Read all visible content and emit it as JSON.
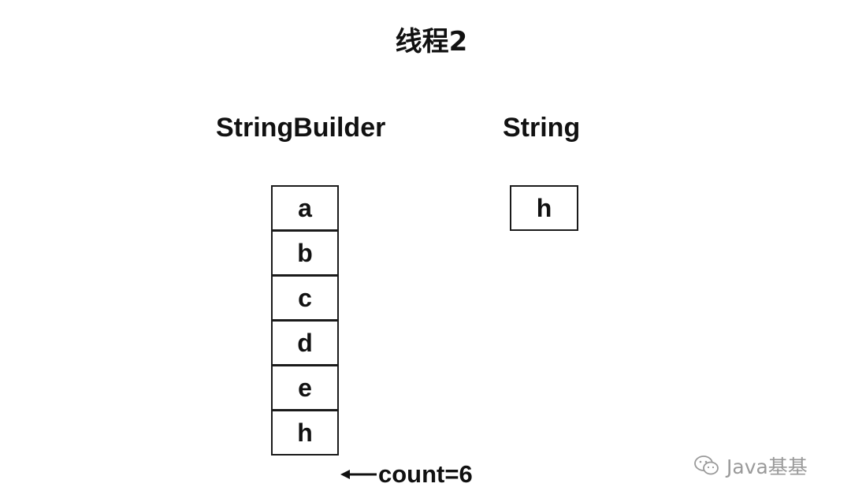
{
  "title": "线程2",
  "labels": {
    "string_builder": "StringBuilder",
    "string": "String"
  },
  "string_builder_cells": [
    "a",
    "b",
    "c",
    "d",
    "e",
    "h"
  ],
  "string_cell": "h",
  "pointer": {
    "text": "count=6"
  },
  "watermark": {
    "text": "Java基基",
    "icon": "wechat-icon"
  }
}
